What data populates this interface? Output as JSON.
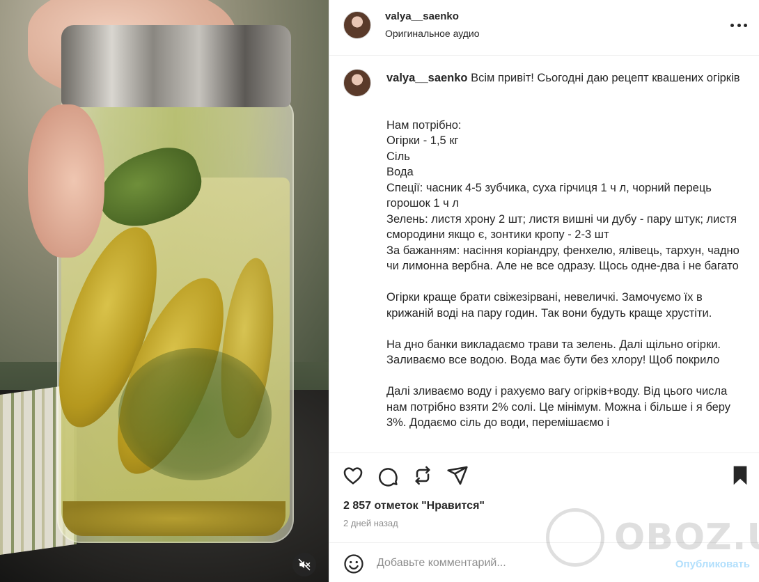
{
  "post": {
    "username": "valya__saenko",
    "audio": "Оригинальное аудио"
  },
  "caption": {
    "username": "valya__saenko",
    "text": " Всім привіт! Сьогодні даю рецепт квашених огірків\n\n\nНам потрібно:\nОгірки - 1,5 кг\nСіль\nВода\nСпеції: часник 4-5 зубчика, суха гірчиця 1 ч л, чорний перець горошок 1 ч л\nЗелень: листя хрону 2 шт; листя вишні чи дубу - пару штук; листя смородини якщо є, зонтики кропу - 2-3 шт\nЗа бажанням: насіння коріандру, фенхелю, ялівець, тархун, чадно чи лимонна вербна. Але не все одразу. Щось одне-два і не багато\n\nОгірки краще брати свіжезірвані, невеличкі. Замочуємо їх в крижаній воді на пару годин. Так вони будуть краще хрустіти.\n\nНа дно банки викладаємо трави та зелень. Далі щільно огірки. Заливаємо все водою. Вода має бути без хлору! Щоб покрило\n\nДалі зливаємо воду і рахуємо вагу огірків+воду. Від цього числа нам потрібно взяти 2% солі. Це мінімум. Можна і більше і я беру 3%. Додаємо сіль до води, перемішаємо і"
  },
  "stats": {
    "likes": "2 857 отметок \"Нравится\"",
    "time_ago": "2 дней назад"
  },
  "composer": {
    "placeholder": "Добавьте комментарий...",
    "publish_label": "Опубликовать"
  },
  "watermark": {
    "text": "OBOZ.UA"
  },
  "icons": {
    "like": "heart-icon",
    "comment": "comment-icon",
    "share": "repost-icon",
    "send": "send-icon",
    "save": "bookmark-icon",
    "emoji": "emoji-icon",
    "more": "more-icon",
    "mute": "muted-speaker-icon"
  },
  "colors": {
    "text": "#262626",
    "secondary": "#8e8e8e",
    "publish_disabled": "#b2dffc",
    "divider": "#efefef"
  }
}
